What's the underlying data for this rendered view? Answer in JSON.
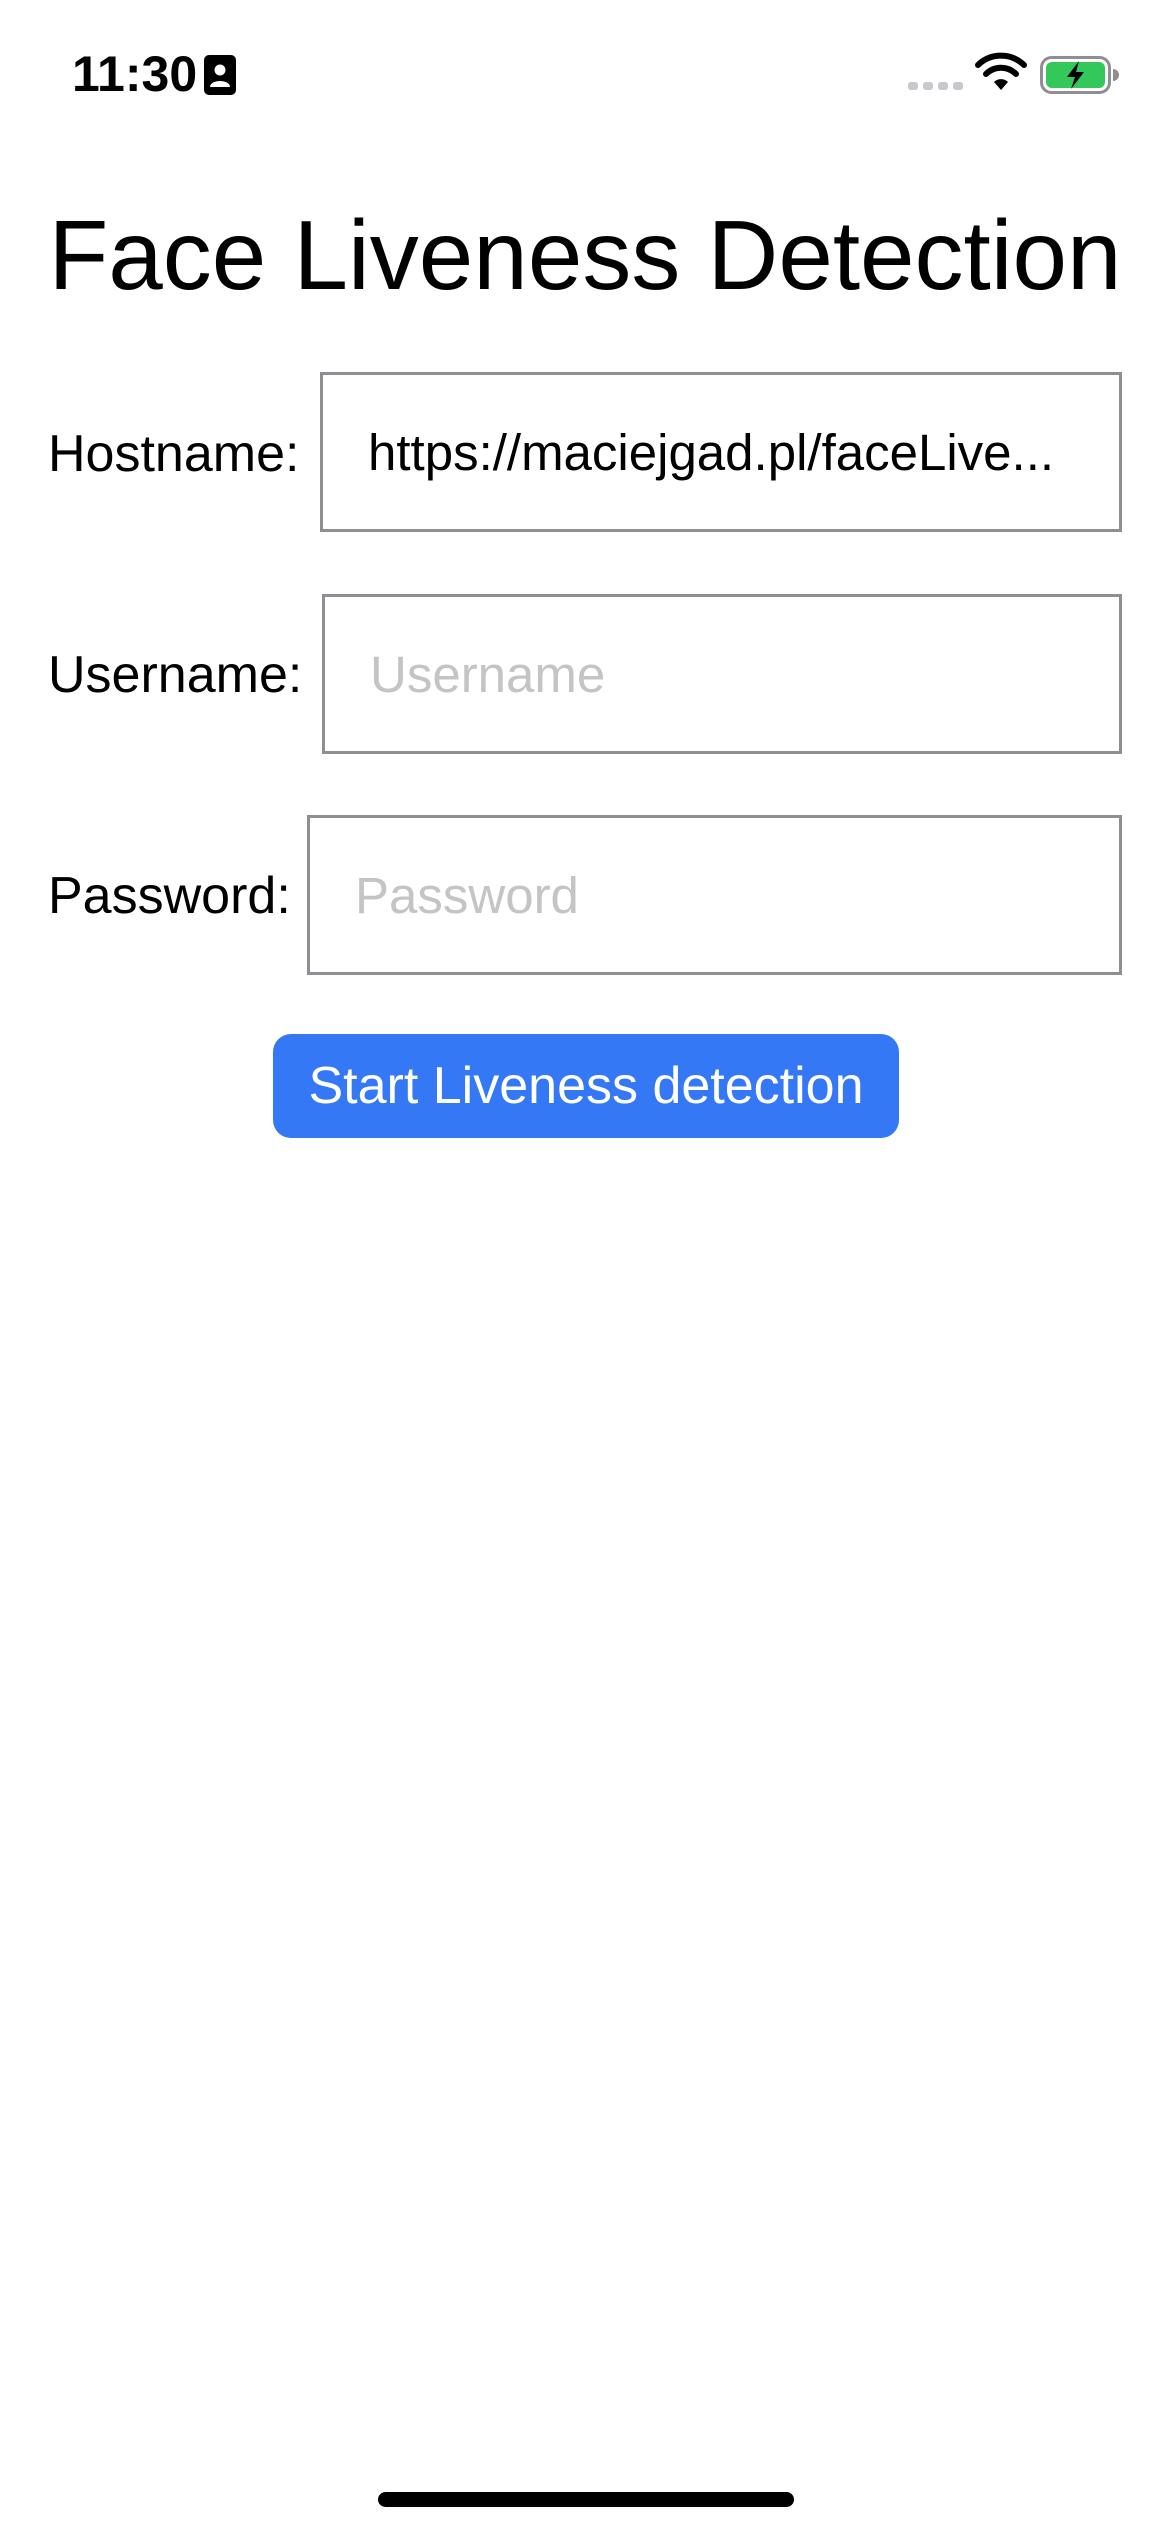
{
  "status_bar": {
    "time": "11:30",
    "icons": [
      "contact-card-icon",
      "cellular-signal-icon",
      "wifi-icon",
      "battery-charging-icon"
    ],
    "battery_color": "#34c759"
  },
  "page": {
    "title": "Face Liveness Detection"
  },
  "form": {
    "hostname": {
      "label": "Hostname:",
      "value": "https://maciejgad.pl/faceLive...",
      "placeholder": ""
    },
    "username": {
      "label": "Username:",
      "value": "",
      "placeholder": "Username"
    },
    "password": {
      "label": "Password:",
      "value": "",
      "placeholder": "Password"
    }
  },
  "actions": {
    "start_label": "Start Liveness detection",
    "accent_color": "#3478f6"
  }
}
